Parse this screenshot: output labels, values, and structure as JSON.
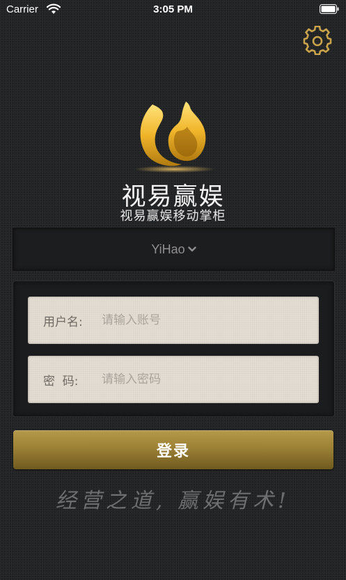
{
  "status_bar": {
    "carrier": "Carrier",
    "time": "3:05 PM"
  },
  "icons": {
    "settings": "gear-icon",
    "wifi": "wifi-icon",
    "battery": "battery-icon",
    "logo": "flame-logo-icon",
    "dropdown": "chevron-down-icon"
  },
  "brand": {
    "name": "视易赢娱",
    "subtitle": "视易赢娱移动掌柜"
  },
  "server_select": {
    "value": "YiHao"
  },
  "form": {
    "username_label": "用户名:",
    "username_placeholder": "请输入账号",
    "password_label": "密  码:",
    "password_placeholder": "请输入密码"
  },
  "login_button": {
    "label": "登录"
  },
  "slogan": "经营之道, 赢娱有术!",
  "colors": {
    "background": "#232425",
    "accent_gold": "#9c8136",
    "field_bg": "#e3ddd2"
  }
}
